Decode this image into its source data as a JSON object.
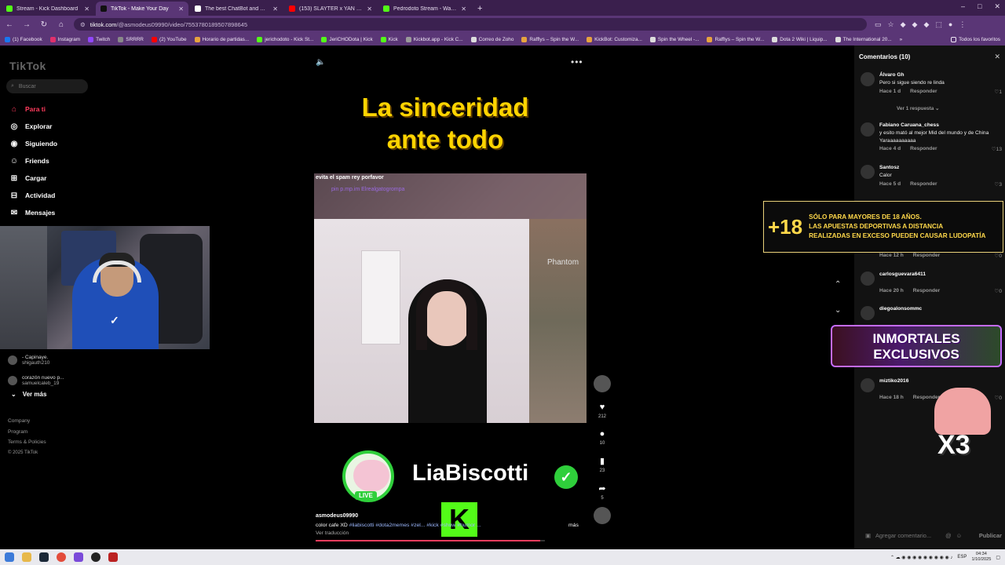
{
  "browser": {
    "tabs": [
      {
        "title": "Stream - Kick Dashboard",
        "color": "#53fc18"
      },
      {
        "title": "TikTok - Make Your Day",
        "color": "#111111"
      },
      {
        "title": "The best ChatBot and Widgets",
        "color": "#ffffff"
      },
      {
        "title": "(153) SLAYTER x YAN BLOCK x",
        "color": "#ff0000"
      },
      {
        "title": "Pedrodoto Stream - Watch Live",
        "color": "#53fc18"
      }
    ],
    "url_host": "tiktok.com",
    "url_path": "/@asmodeus09990/video/7553780189507898645",
    "bookmarks": [
      "(1) Facebook",
      "Instagram",
      "Twitch",
      "SRRRR",
      "(2) YouTube",
      "Horario de partidas...",
      "jerichodoto - Kick St...",
      "JeriCHODota | Kick",
      "Kick",
      "Kickbot.app - Kick C...",
      "Correo de Zoho",
      "Rafflys – Spin the W...",
      "KickBot: Customiza...",
      "Spin the Wheel -...",
      "Rafflys – Spin the W...",
      "Dota 2 Wiki | Liquip...",
      "The International 20..."
    ],
    "bookmarks_right": "Todos los favoritos"
  },
  "sidebar": {
    "logo": "TikTok",
    "search_placeholder": "Buscar",
    "nav": [
      {
        "label": "Para ti",
        "icon": "home-icon",
        "glyph": "⌂"
      },
      {
        "label": "Explorar",
        "icon": "compass-icon",
        "glyph": "◎"
      },
      {
        "label": "Siguiendo",
        "icon": "following-icon",
        "glyph": "◉"
      },
      {
        "label": "Friends",
        "icon": "friends-icon",
        "glyph": "☺"
      },
      {
        "label": "Cargar",
        "icon": "upload-icon",
        "glyph": "⊞"
      },
      {
        "label": "Actividad",
        "icon": "activity-icon",
        "glyph": "⊟"
      },
      {
        "label": "Mensajes",
        "icon": "messages-icon",
        "glyph": "✉"
      }
    ],
    "following": [
      {
        "line1": "- Capinaye. ",
        "line2": "shigauth210"
      },
      {
        "line1": "corazón nuevo p...",
        "line2": "samuelcaleb_19"
      }
    ],
    "ver_mas": "Ver más",
    "footer": [
      "Company",
      "Program",
      "Terms & Policies"
    ],
    "copyright": "© 2025 TikTok"
  },
  "video": {
    "title_line1": "La sinceridad",
    "title_line2": "ante todo",
    "chat_line1": "evita el spam rey porfavor",
    "chat_line2": "pin p.mp.im Elrealgatogrompa",
    "game_label": "Phantom",
    "channel_name": "LiaBiscotti",
    "live_label": "LIVE",
    "author": "asmodeus09990",
    "desc_text": "color cafe  XD",
    "desc_tags": "#liabiscotti #dota2memes #zel... #kick #show #humor ...",
    "more": "más",
    "translate": "Ver traducción",
    "progress": 0.98,
    "likes": "212",
    "comments": "10",
    "saves": "23",
    "shares": "5"
  },
  "comments_panel": {
    "header": "Comentarios (10)",
    "replies_label": "Ver 1 respuesta",
    "reply_label": "Responder",
    "items": [
      {
        "user": "Álvaro Gh",
        "text": "Pero si sigue siendo re linda",
        "time": "Hace 1 d",
        "likes": "1"
      },
      {
        "user": "Fabiano Caruana_chess",
        "text": "y esito mató al mejor Mid del mundo y de China",
        "text2": "Yaraaaaaaaaaa",
        "time": "Hace 4 d",
        "likes": "13"
      },
      {
        "user": "Santosz",
        "text": "Calor",
        "time": "Hace 5 d",
        "likes": "3"
      },
      {
        "user": "",
        "text": "",
        "time": "Hace 12 h",
        "likes": "0"
      },
      {
        "user": "carlosguevara6411",
        "text": "",
        "time": "Hace 20 h",
        "likes": "0"
      },
      {
        "user": "diegoalonsommc",
        "text": "",
        "time": "",
        "likes": ""
      },
      {
        "user": "miztiko2016",
        "text": "",
        "time": "Hace 18 h",
        "likes": "0"
      }
    ],
    "input_placeholder": "Agregar comentario...",
    "publish": "Publicar"
  },
  "overlays": {
    "age_big": "+18",
    "age_line1": "SÓLO PARA MAYORES DE 18 AÑOS.",
    "age_line2": "LAS APUESTAS DEPORTIVAS A DISTANCIA",
    "age_line3": "REALIZADAS EN EXCESO PUEDEN CAUSAR LUDOPATÍA",
    "inmortales_line1": "INMORTALES",
    "inmortales_line2": "EXCLUSIVOS",
    "multiplier": "X3"
  },
  "taskbar": {
    "lang": "ESP",
    "time": "04:34",
    "date": "1/10/2025"
  }
}
